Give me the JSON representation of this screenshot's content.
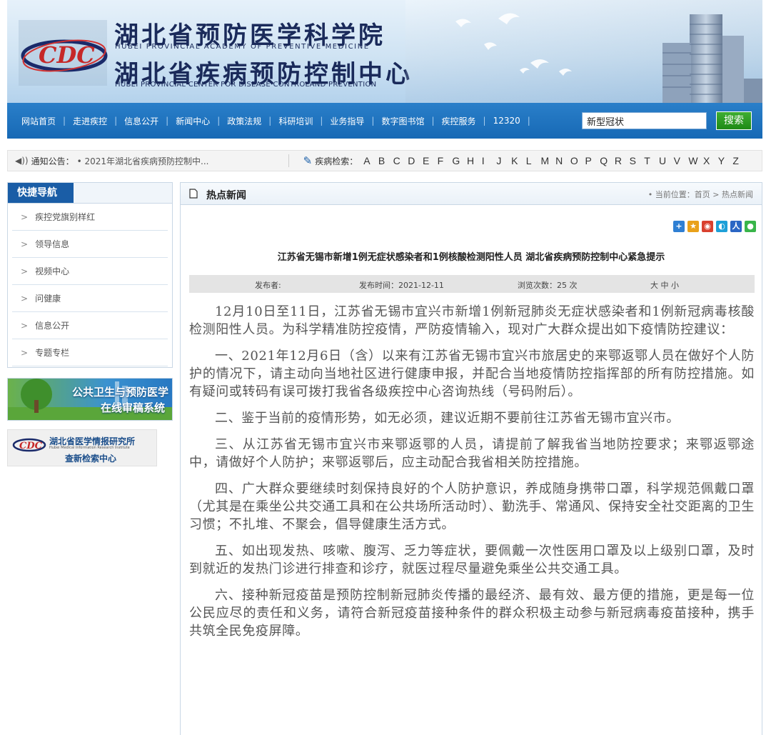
{
  "banner": {
    "title_cn_1": "湖北省预防医学科学院",
    "title_en_1": "HUBEI PROVINCIAL ACADEMY OF PREVENTIVE MEDICINE",
    "title_cn_2": "湖北省疾病预防控制中心",
    "title_en_2": "HUBEI PROVINCIAL CENTER FOR DISEASE CONTROLAND PREVENTION",
    "logo_text": "CDC"
  },
  "nav": {
    "items": [
      "网站首页",
      "走进疾控",
      "信息公开",
      "新闻中心",
      "政策法规",
      "科研培训",
      "业务指导",
      "数字图书馆",
      "疾控服务",
      "12320"
    ],
    "search_value": "新型冠状",
    "search_button": "搜索"
  },
  "notice": {
    "label": "通知公告：",
    "text": "• 2021年湖北省疾病预防控制中...",
    "disease_label": "疾病检索：",
    "letters": [
      "A",
      "B",
      "C",
      "D",
      "E",
      "F",
      "G",
      "H",
      "I",
      "J",
      "K",
      "L",
      "M",
      "N",
      "O",
      "P",
      "Q",
      "R",
      "S",
      "T",
      "U",
      "V",
      "W",
      "X",
      "Y",
      "Z"
    ]
  },
  "sidebar": {
    "title": "快捷导航",
    "items": [
      "疾控党旗别样红",
      "领导信息",
      "视频中心",
      "问健康",
      "信息公开",
      "专题专栏"
    ],
    "ad1_line1": "公共卫生与预防医学",
    "ad1_line2": "在线审稿系统",
    "ad2_title": "湖北省医学情报研究所",
    "ad2_en": "Hubei Medical Information Research Institute",
    "ad2_sub": "查新检索中心"
  },
  "main": {
    "section_title": "热点新闻",
    "breadcrumb": "• 当前位置：首页 > 热点新闻",
    "article_title": "江苏省无锡市新增1例无症状感染者和1例核酸检测阳性人员 湖北省疾病预防控制中心紧急提示",
    "meta": {
      "publisher": "发布者:",
      "time": "发布时间：2021-12-11",
      "views": "浏览次数：25 次",
      "font_size": "大 中 小"
    },
    "paragraphs": [
      "12月10日至11日，江苏省无锡市宜兴市新增1例新冠肺炎无症状感染者和1例新冠病毒核酸检测阳性人员。为科学精准防控疫情，严防疫情输入，现对广大群众提出如下疫情防控建议：",
      "一、2021年12月6日（含）以来有江苏省无锡市宜兴市旅居史的来鄂返鄂人员在做好个人防护的情况下，请主动向当地社区进行健康申报，并配合当地疫情防控指挥部的所有防控措施。如有疑问或转码有误可拨打我省各级疾控中心咨询热线（号码附后）。",
      "二、鉴于当前的疫情形势，如无必须，建议近期不要前往江苏省无锡市宜兴市。",
      "三、从江苏省无锡市宜兴市来鄂返鄂的人员，请提前了解我省当地防控要求；来鄂返鄂途中，请做好个人防护；来鄂返鄂后，应主动配合我省相关防控措施。",
      "四、广大群众要继续时刻保持良好的个人防护意识，养成随身携带口罩，科学规范佩戴口罩（尤其是在乘坐公共交通工具和在公共场所活动时）、勤洗手、常通风、保持安全社交距离的卫生习惯；不扎堆、不聚会，倡导健康生活方式。",
      "五、如出现发热、咳嗽、腹泻、乏力等症状，要佩戴一次性医用口罩及以上级别口罩，及时到就近的发热门诊进行排查和诊疗，就医过程尽量避免乘坐公共交通工具。",
      "六、接种新冠疫苗是预防控制新冠肺炎传播的最经济、最有效、最方便的措施，更是每一位公民应尽的责任和义务，请符合新冠疫苗接种条件的群众积极主动参与新冠病毒疫苗接种，携手共筑全民免疫屏障。"
    ]
  },
  "colors": {
    "nav_blue": "#1769b5",
    "sidebar_tab": "#1a5da6",
    "search_green": "#1e8a16"
  }
}
